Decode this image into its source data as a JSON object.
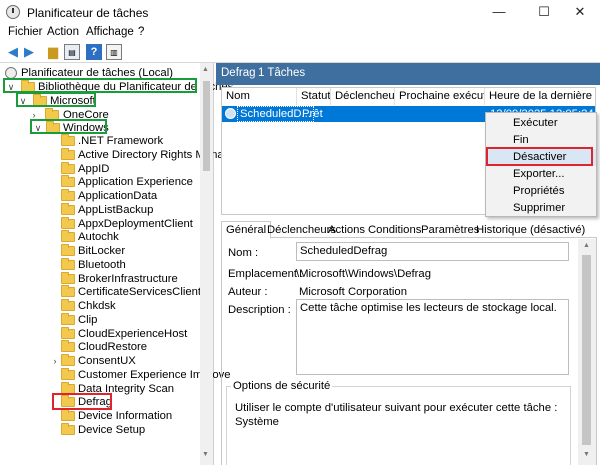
{
  "window": {
    "title": "Planificateur de tâches",
    "minimize": "—",
    "maximize": "☐",
    "close": "✕"
  },
  "menu": [
    "Fichier",
    "Action",
    "Affichage",
    "?"
  ],
  "toolbar": [
    "back-icon",
    "forward-icon",
    "folder-up-icon",
    "properties-icon",
    "help-icon",
    "panel-icon"
  ],
  "tree": {
    "root": "Planificateur de tâches (Local)",
    "library": "Bibliothèque du Planificateur de tâches",
    "microsoft": "Microsoft",
    "onecore": "OneCore",
    "windows": "Windows",
    "children": [
      ".NET Framework",
      "Active Directory Rights Manag",
      "AppID",
      "Application Experience",
      "ApplicationData",
      "AppListBackup",
      "AppxDeploymentClient",
      "Autochk",
      "BitLocker",
      "Bluetooth",
      "BrokerInfrastructure",
      "CertificateServicesClient",
      "Chkdsk",
      "Clip",
      "CloudExperienceHost",
      "CloudRestore",
      "ConsentUX",
      "Customer Experience Improve",
      "Data Integrity Scan",
      "Defrag",
      "Device Information",
      "Device Setup"
    ]
  },
  "header": {
    "folder": "Defrag",
    "count": "1 Tâches"
  },
  "table": {
    "columns": [
      "Nom",
      "Statut",
      "Déclencheurs",
      "Prochaine exécution",
      "Heure de la dernière exécu"
    ],
    "row": {
      "name": "ScheduledD...",
      "status": "Prêt",
      "last_run": "12/09/2025 12:05:24"
    }
  },
  "context_menu": [
    "Exécuter",
    "Fin",
    "Désactiver",
    "Exporter...",
    "Propriétés",
    "Supprimer"
  ],
  "tabs": [
    "Général",
    "Déclencheurs",
    "Actions",
    "Conditions",
    "Paramètres",
    "Historique (désactivé)"
  ],
  "details": {
    "name_label": "Nom :",
    "name_value": "ScheduledDefrag",
    "location_label": "Emplacement :",
    "location_value": "\\Microsoft\\Windows\\Defrag",
    "author_label": "Auteur :",
    "author_value": "Microsoft Corporation",
    "description_label": "Description :",
    "description_value": "Cette tâche optimise les lecteurs de stockage local.",
    "security_title": "Options de sécurité",
    "security_text": "Utiliser le compte d'utilisateur suivant pour exécuter cette tâche :",
    "account": "Système"
  },
  "colors": {
    "selection": "#0078d7",
    "header": "#3e6f9e",
    "highlight_red": "#e0242e",
    "highlight_green": "#1a9c3a"
  }
}
